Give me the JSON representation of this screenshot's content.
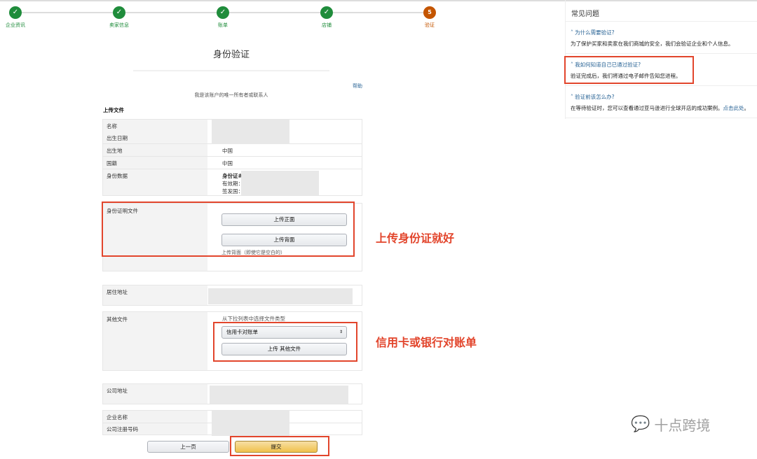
{
  "steps": [
    {
      "label": "企业资讯",
      "done": true
    },
    {
      "label": "卖家信息",
      "done": true
    },
    {
      "label": "账单",
      "done": true
    },
    {
      "label": "店铺",
      "done": true
    },
    {
      "label": "验证",
      "number": "5",
      "done": false
    }
  ],
  "title": "身份验证",
  "help_link": "帮助",
  "owner_note": "我是该账户的唯一所有者或联系人",
  "upload_section": "上传文件",
  "personal": {
    "name_label": "名称",
    "dob_label": "出生日期",
    "birthplace_label": "出生地",
    "birthplace": "中国",
    "nationality_label": "国籍",
    "nationality": "中国",
    "id_label": "身份数据",
    "id_no": "身份证#",
    "expiry": "有效期：",
    "issuer": "签发国："
  },
  "id_docs": {
    "label": "身份证明文件",
    "front_btn": "上传正面",
    "back_btn": "上传背面",
    "back_note": "上传背面（即使它是空白的）"
  },
  "residence_label": "居住地址",
  "other_docs": {
    "label": "其他文件",
    "hint": "从下拉列表中选择文件类型",
    "selected": "信用卡对账单",
    "upload_btn": "上传 其他文件"
  },
  "company_address_label": "公司地址",
  "company_name_label": "企业名称",
  "company_reg_label": "公司注册号码",
  "prev_btn": "上一页",
  "submit_btn": "提交",
  "annotations": {
    "id": "上传身份证就好",
    "other": "信用卡或银行对账单"
  },
  "faq": {
    "title": "常见问题",
    "items": [
      {
        "q": "为什么需要验证?",
        "a": "为了保护买家和卖家在我们商城的安全，我们会验证企业和个人信息。"
      },
      {
        "q": "我如何知道自己已通过验证?",
        "a": "验证完成后，我们将通过电子邮件告知您进程。"
      },
      {
        "q": "验证前该怎么办?",
        "a": "在等待验证时，您可以查看通过亚马逊进行全球开店的成功案例。",
        "link": "点击此处",
        "end": "。"
      }
    ]
  },
  "watermark": "十点跨境"
}
